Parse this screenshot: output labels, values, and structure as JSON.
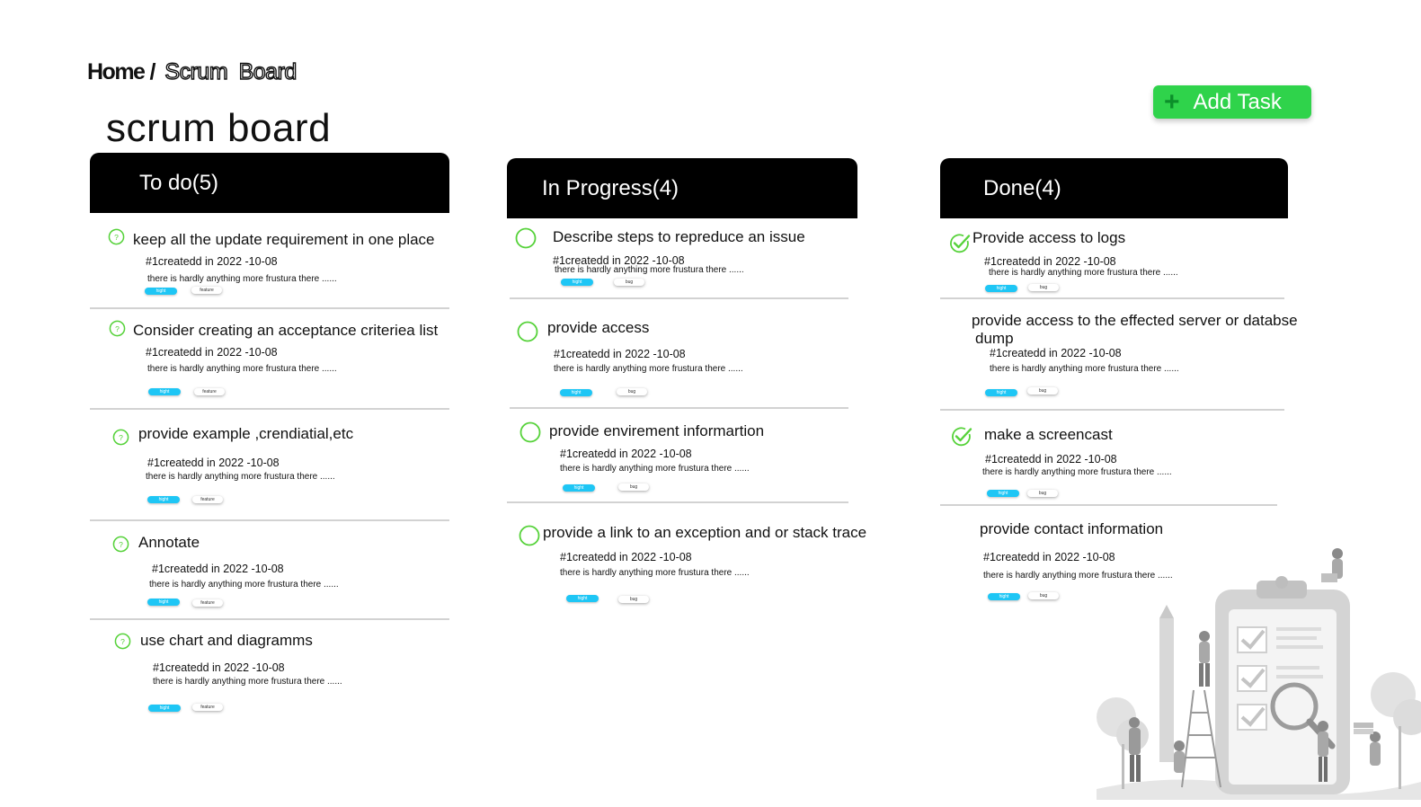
{
  "breadcrumb": {
    "home": "Home",
    "separator": "/",
    "current": "Scrum Board"
  },
  "page_title": "scrum board",
  "add_task": {
    "label": "Add Task",
    "icon": "plus-icon"
  },
  "colors": {
    "header": "#000000",
    "accent_green": "#2fd34b",
    "status_green": "#56d23a",
    "tag_blue": "#1ec6f5"
  },
  "columns": [
    {
      "title": "To do(5)",
      "cards": [
        {
          "title": "keep all the update requirement in one place",
          "meta": "#1createdd in 2022 -10-08",
          "desc": "there is hardly  anything more frustura there ......",
          "priority": "hight",
          "type": "feature",
          "status": "question-circle-icon"
        },
        {
          "title": "Consider creating an acceptance criteriea list",
          "meta": "#1createdd in 2022 -10-08",
          "desc": "there is hardly  anything more frustura there ......",
          "priority": "hight",
          "type": "feature",
          "status": "question-circle-icon"
        },
        {
          "title": "provide example ,crendiatial,etc",
          "meta": "#1createdd in 2022 -10-08",
          "desc": "there is hardly  anything more frustura there ......",
          "priority": "hight",
          "type": "feature",
          "status": "question-circle-icon"
        },
        {
          "title": "Annotate",
          "meta": "#1createdd in 2022 -10-08",
          "desc": "there is hardly  anything more frustura there ......",
          "priority": "hight",
          "type": "feature",
          "status": "question-circle-icon"
        },
        {
          "title": "use chart and diagramms",
          "meta": "#1createdd in 2022 -10-08",
          "desc": "there is hardly  anything more frustura there ......",
          "priority": "hight",
          "type": "feature",
          "status": "question-circle-icon"
        }
      ]
    },
    {
      "title": "In Progress(4)",
      "cards": [
        {
          "title": "Describe steps to repreduce an issue",
          "meta": "#1createdd in 2022 -10-08",
          "desc": "there is hardly  anything more frustura there ......",
          "priority": "hight",
          "type": "bug",
          "status": "empty-circle-icon"
        },
        {
          "title": "provide access",
          "meta": "#1createdd in 2022 -10-08",
          "desc": "there is hardly  anything more frustura there ......",
          "priority": "hight",
          "type": "bug",
          "status": "empty-circle-icon"
        },
        {
          "title": "provide envirement  informartion",
          "meta": "#1createdd in 2022 -10-08",
          "desc": "there is hardly  anything more frustura there ......",
          "priority": "hight",
          "type": "bug",
          "status": "empty-circle-icon"
        },
        {
          "title": "provide a link to an exception and or stack trace",
          "meta": "#1createdd in 2022 -10-08",
          "desc": "there is hardly  anything more frustura there ......",
          "priority": "hight",
          "type": "bug",
          "status": "empty-circle-icon"
        }
      ]
    },
    {
      "title": "Done(4)",
      "cards": [
        {
          "title": "Provide access to logs",
          "meta": "#1createdd in 2022 -10-08",
          "desc": "there is hardly  anything more frustura there ......",
          "priority": "hight",
          "type": "bug",
          "status": "check-circle-icon"
        },
        {
          "title": "provide access  to the effected  server or databse",
          "title2": "dump",
          "meta": "#1createdd in 2022 -10-08",
          "desc": "there is hardly  anything more frustura there ......",
          "priority": "hight",
          "type": "bug",
          "status": "none"
        },
        {
          "title": "make a screencast",
          "meta": "#1createdd in 2022 -10-08",
          "desc": "there is hardly  anything more frustura there ......",
          "priority": "hight",
          "type": "bug",
          "status": "check-circle-icon"
        },
        {
          "title": "provide contact information",
          "meta": "#1createdd in 2022 -10-08",
          "desc": "there is hardly  anything more frustura there ......",
          "priority": "hight",
          "type": "bug",
          "status": "none"
        }
      ]
    }
  ]
}
